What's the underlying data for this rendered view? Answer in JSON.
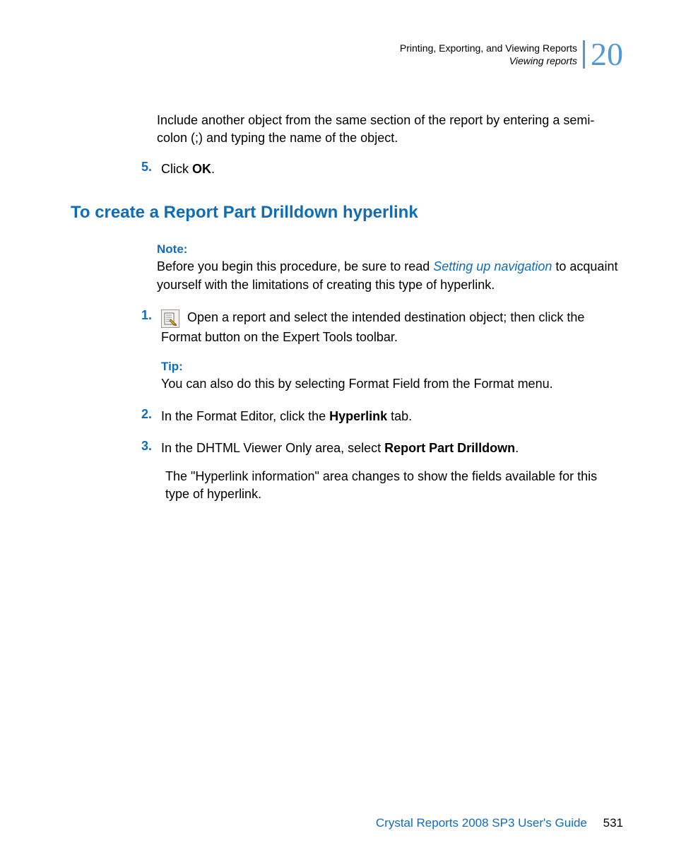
{
  "header": {
    "line1": "Printing, Exporting, and Viewing Reports",
    "line2": "Viewing reports",
    "chapter": "20"
  },
  "content": {
    "para1": "Include another object from the same section of the report by entering a semi-colon (;) and typing the name of the object.",
    "step5_num": "5.",
    "step5_prefix": "Click ",
    "step5_bold": "OK",
    "step5_suffix": ".",
    "heading": "To create a Report Part Drilldown hyperlink",
    "note_label": "Note:",
    "note_before_link": "Before you begin this procedure, be sure to read ",
    "note_link": "Setting up navigation",
    "note_after_link": " to acquaint yourself with the limitations of creating this type of hyperlink.",
    "step1_num": "1.",
    "step1_body": " Open a report and select the intended destination object; then click the Format button on the Expert Tools toolbar.",
    "tip_label": "Tip:",
    "tip_body": "You can also do this by selecting Format Field from the Format menu.",
    "step2_num": "2.",
    "step2_prefix": "In the Format Editor, click the ",
    "step2_bold": "Hyperlink",
    "step2_suffix": " tab.",
    "step3_num": "3.",
    "step3_prefix": "In the DHTML Viewer Only area, select ",
    "step3_bold": "Report Part Drilldown",
    "step3_suffix": ".",
    "step3_after": "The \"Hyperlink information\" area changes to show the fields available for this type of hyperlink."
  },
  "footer": {
    "text": "Crystal Reports 2008 SP3 User's Guide",
    "page": "531"
  }
}
